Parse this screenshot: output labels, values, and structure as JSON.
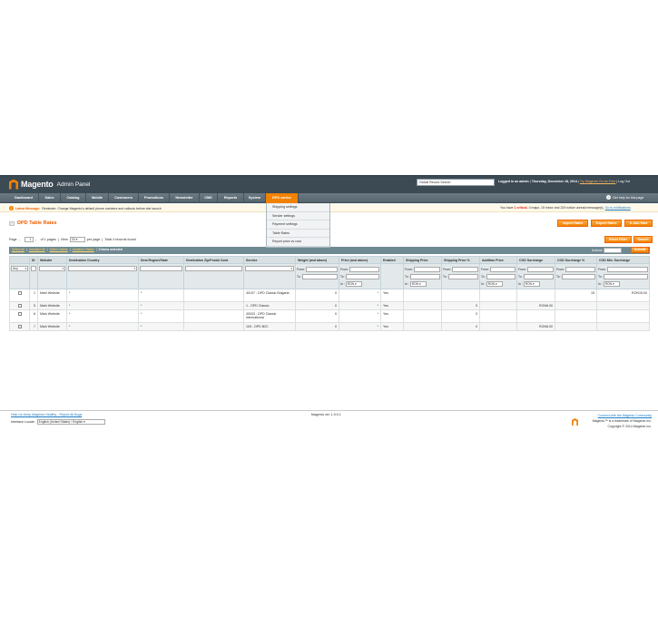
{
  "header": {
    "logo_text": "Magento",
    "logo_sub": "Admin Panel",
    "search_value": "Global Record Search",
    "logged_as": "Logged in as admin",
    "date": "Thursday, December 18, 2014",
    "try_link": "Try Magento Go for Free",
    "logout": "Log Out"
  },
  "nav": {
    "items": [
      {
        "label": "Dashboard"
      },
      {
        "label": "Sales"
      },
      {
        "label": "Catalog"
      },
      {
        "label": "Mobile"
      },
      {
        "label": "Customers"
      },
      {
        "label": "Promotions"
      },
      {
        "label": "Newsletter"
      },
      {
        "label": "CMS"
      },
      {
        "label": "Reports"
      },
      {
        "label": "System"
      },
      {
        "label": "DPD carrier"
      }
    ],
    "help": "Get help for this page",
    "dropdown": [
      "Shipping settings",
      "Sender settings",
      "Payment settings",
      "Table Rates",
      "Report price vs cost"
    ]
  },
  "message": {
    "label": "Latest Message:",
    "text": "Reminder: Change Magento's default phone numbers and callouts before site launch",
    "right_prefix": "You have",
    "critical": "1 critical",
    "right_rest": ", 0 major, 19 minor and 229 notice unread message(s).",
    "goto": "Go to notifications"
  },
  "page": {
    "title": "DPD Table Rates",
    "import": "Import Rates",
    "export": "Export Rates",
    "add": "Add Rate"
  },
  "pager": {
    "page_label": "Page",
    "page": "1",
    "of_pages": "of 1 pages",
    "view": "View",
    "per_page": "20",
    "per_page_label": "per page",
    "total": "Total 4 records found",
    "reset": "Reset Filter",
    "search": "Search"
  },
  "mass": {
    "select_all": "Select All",
    "unselect_all": "Unselect All",
    "select_visible": "Select Visible",
    "unselect_visible": "Unselect Visible",
    "selected": "0 items selected",
    "actions": "Actions",
    "submit": "Submit"
  },
  "grid": {
    "columns": [
      "",
      "ID",
      "Website",
      "Destination Country",
      "Dest.Region/State",
      "Destination Zip/Postal Code",
      "Service",
      "Weight (and above)",
      "Price (and above)",
      "Enabled",
      "Shipping Price",
      "Shipping Price %",
      "Addition Price",
      "COD Surcharge",
      "COD Surcharge %",
      "COD Min. Surcharge"
    ],
    "filter": {
      "any": "Any",
      "from": "From:",
      "to": "To :",
      "in": "In :",
      "currency": "RON"
    },
    "rows": [
      {
        "id": "1",
        "website": "Main Website",
        "country": "*",
        "region": "*",
        "zip": "",
        "service": "40107 - DPD Classic Bulgaria",
        "weight": "0",
        "price": "*",
        "enabled": "Yes",
        "ship": "",
        "ship_pct": "",
        "add": "",
        "cod": "",
        "cod_pct": "15",
        "cod_min": "RON15.00"
      },
      {
        "id": "5",
        "website": "Main Website",
        "country": "*",
        "region": "*",
        "zip": "",
        "service": "1 - DPD Classic",
        "weight": "0",
        "price": "*",
        "enabled": "Yes",
        "ship": "",
        "ship_pct": "0",
        "add": "",
        "cod": "RON8.00",
        "cod_pct": "",
        "cod_min": ""
      },
      {
        "id": "6",
        "website": "Main Website",
        "country": "*",
        "region": "*",
        "zip": "",
        "service": "40033 - DPD Classic International",
        "weight": "0",
        "price": "*",
        "enabled": "Yes",
        "ship": "",
        "ship_pct": "0",
        "add": "",
        "cod": "",
        "cod_pct": "",
        "cod_min": ""
      },
      {
        "id": "7",
        "website": "Main Website",
        "country": "*",
        "region": "*",
        "zip": "",
        "service": "109 - DPD B2C",
        "weight": "0",
        "price": "*",
        "enabled": "Yes",
        "ship": "",
        "ship_pct": "0",
        "add": "",
        "cod": "RON8.00",
        "cod_pct": "",
        "cod_min": ""
      }
    ]
  },
  "footer": {
    "help_link": "Help Us Keep Magento Healthy - Report All Bugs",
    "locale_label": "Interface Locale:",
    "locale_value": "English (United States) / English",
    "version": "Magento ver. 1.9.0.1",
    "community": "Connect with the Magento Community",
    "trademark": "Magento™ is a trademark of Magento Inc.",
    "copyright": "Copyright © 2014 Magento Inc."
  }
}
